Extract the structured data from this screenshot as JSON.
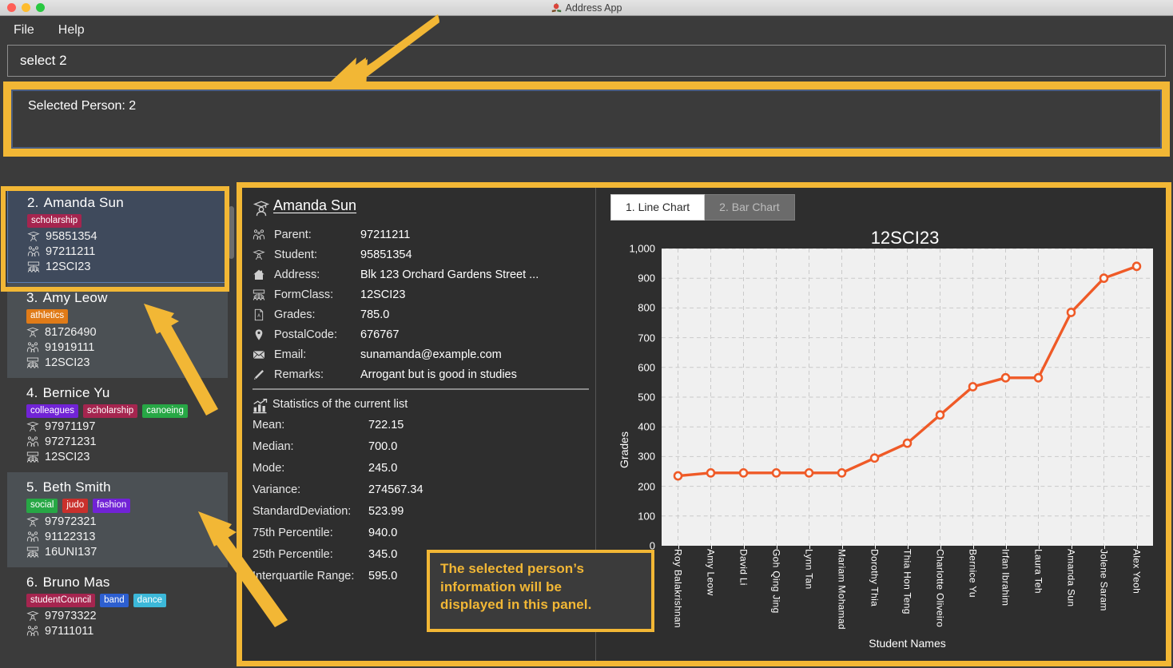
{
  "window": {
    "title": "Address App",
    "app_icon": "book-icon",
    "traffic_lights": [
      "close",
      "minimize",
      "zoom"
    ]
  },
  "menubar": {
    "items": [
      {
        "label": "File",
        "name": "menu-file"
      },
      {
        "label": "Help",
        "name": "menu-help"
      }
    ]
  },
  "command": {
    "value": "select 2",
    "placeholder": ""
  },
  "result": {
    "text": "Selected Person: 2"
  },
  "person_list": {
    "scrollbar": true,
    "items": [
      {
        "index": "2.",
        "name": "Amanda Sun",
        "selected": true,
        "tags": [
          {
            "label": "scholarship",
            "color": "#a5254f"
          }
        ],
        "student": "95851354",
        "parent": "97211211",
        "formclass": "12SCI23"
      },
      {
        "index": "3.",
        "name": "Amy Leow",
        "selected": false,
        "tags": [
          {
            "label": "athletics",
            "color": "#e07b18"
          }
        ],
        "student": "81726490",
        "parent": "91919111",
        "formclass": "12SCI23"
      },
      {
        "index": "4.",
        "name": "Bernice Yu",
        "selected": false,
        "tags": [
          {
            "label": "colleagues",
            "color": "#7123d6"
          },
          {
            "label": "scholarship",
            "color": "#a5254f"
          },
          {
            "label": "canoeing",
            "color": "#27a745"
          }
        ],
        "student": "97971197",
        "parent": "97271231",
        "formclass": "12SCI23"
      },
      {
        "index": "5.",
        "name": "Beth Smith",
        "selected": false,
        "tags": [
          {
            "label": "social",
            "color": "#27a745"
          },
          {
            "label": "judo",
            "color": "#c9302c"
          },
          {
            "label": "fashion",
            "color": "#7123d6"
          }
        ],
        "student": "97972321",
        "parent": "91122313",
        "formclass": "16UNI137"
      },
      {
        "index": "6.",
        "name": "Bruno Mas",
        "selected": false,
        "tags": [
          {
            "label": "studentCouncil",
            "color": "#a5254f"
          },
          {
            "label": "band",
            "color": "#2d5fd0"
          },
          {
            "label": "dance",
            "color": "#3cb8d9"
          }
        ],
        "student": "97973322",
        "parent": "97111011",
        "formclass": ""
      }
    ]
  },
  "details": {
    "name": "Amanda Sun",
    "avatar_icon": "graduate-icon",
    "fields": [
      {
        "icon": "parents-icon",
        "label": "Parent:",
        "value": "97211211"
      },
      {
        "icon": "student-icon",
        "label": "Student:",
        "value": "95851354"
      },
      {
        "icon": "home-icon",
        "label": "Address:",
        "value": "Blk 123 Orchard Gardens Street ..."
      },
      {
        "icon": "class-icon",
        "label": "FormClass:",
        "value": "12SCI23"
      },
      {
        "icon": "grades-icon",
        "label": "Grades:",
        "value": "785.0"
      },
      {
        "icon": "pin-icon",
        "label": "PostalCode:",
        "value": "676767"
      },
      {
        "icon": "envelope-icon",
        "label": "Email:",
        "value": "sunamanda@example.com"
      },
      {
        "icon": "pencil-icon",
        "label": "Remarks:",
        "value": "Arrogant but is good in studies"
      }
    ]
  },
  "statistics": {
    "icon": "bar-chart-icon",
    "title": "Statistics of the current list",
    "rows": [
      {
        "label": "Mean:",
        "value": "722.15"
      },
      {
        "label": "Median:",
        "value": "700.0"
      },
      {
        "label": "Mode:",
        "value": "245.0"
      },
      {
        "label": "Variance:",
        "value": "274567.34"
      },
      {
        "label": "StandardDeviation:",
        "value": "523.99"
      },
      {
        "label": "75th Percentile:",
        "value": "940.0"
      },
      {
        "label": "25th Percentile:",
        "value": "345.0"
      },
      {
        "label": "Interquartile Range:",
        "value": "595.0"
      }
    ]
  },
  "chart_tabs": [
    {
      "label": "1. Line Chart",
      "active": true
    },
    {
      "label": "2. Bar Chart",
      "active": false
    }
  ],
  "chart_data": {
    "type": "line",
    "title": "12SCI23",
    "xlabel": "Student Names",
    "ylabel": "Grades",
    "ylim": [
      0,
      1000
    ],
    "yticks": [
      0,
      100,
      200,
      300,
      400,
      500,
      600,
      700,
      800,
      900,
      1000
    ],
    "ytick_labels": [
      "0",
      "100",
      "200",
      "300",
      "400",
      "500",
      "600",
      "700",
      "800",
      "900",
      "1,000"
    ],
    "grid": true,
    "legend": "none",
    "line_color": "#ef5a27",
    "marker": "open-circle",
    "categories": [
      "Roy Balakrishnan",
      "Amy Leow",
      "David Li",
      "Goh Qing Jing",
      "Lynn Tan",
      "Mariam Mohamad",
      "Dorothy Thia",
      "Thia Hon Teng",
      "Charlotte Oliveiro",
      "Bernice Yu",
      "Irfan Ibrahim",
      "Laura Teh",
      "Amanda Sun",
      "Jolene Saram",
      "Alex Yeoh"
    ],
    "values": [
      235,
      245,
      245,
      245,
      245,
      245,
      295,
      345,
      440,
      535,
      565,
      565,
      785,
      900,
      940
    ]
  },
  "annotations": {
    "callout": {
      "line1": "The selected person’s",
      "line2": "information will be",
      "line3": "displayed in this panel."
    },
    "arrows": [
      {
        "name": "arrow-to-result-panel",
        "points_to": "result"
      },
      {
        "name": "arrow-to-selected-person",
        "points_to": "person_list_selected"
      },
      {
        "name": "arrow-to-details-panel",
        "points_to": "details"
      }
    ],
    "highlight_color": "#f2b735"
  }
}
